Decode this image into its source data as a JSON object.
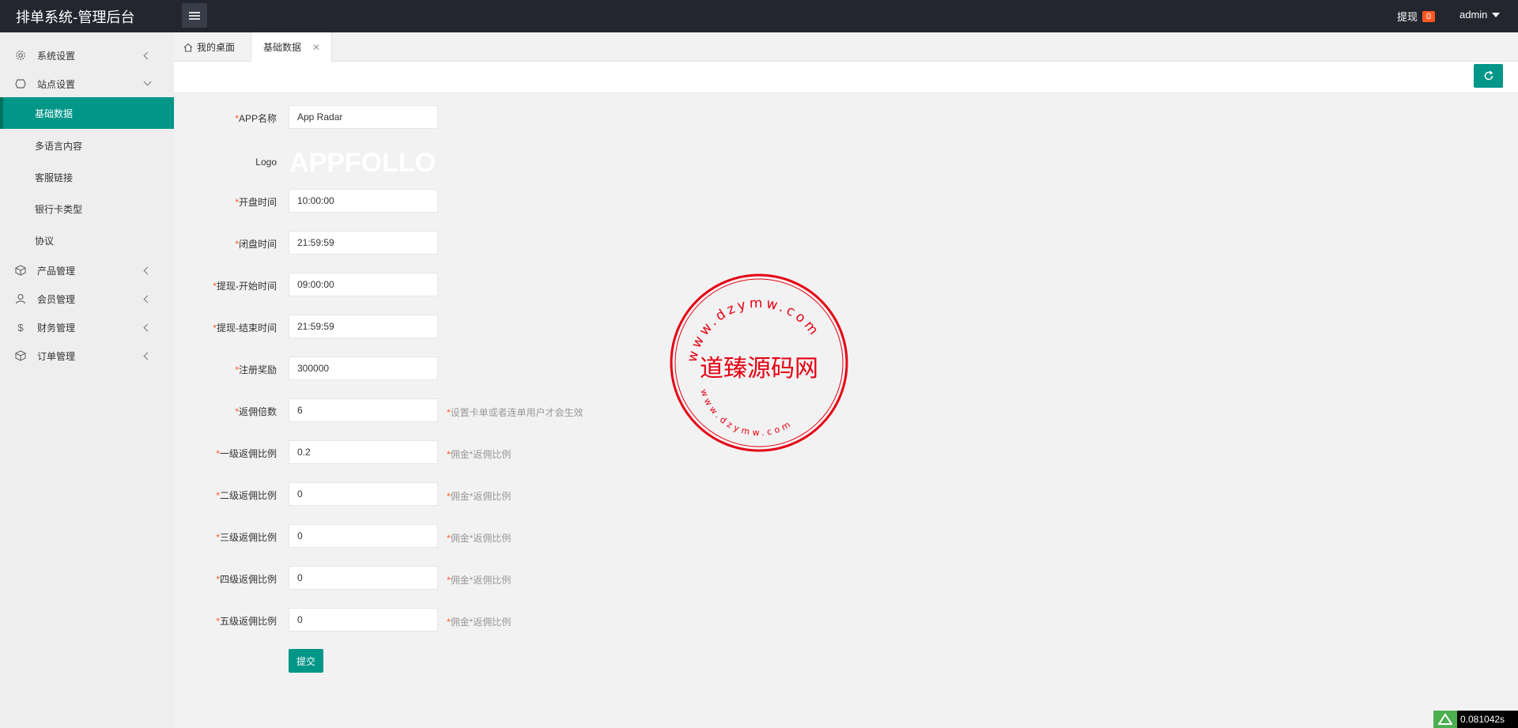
{
  "header": {
    "title": "排单系统-管理后台",
    "withdraw_label": "提现",
    "withdraw_count": "0",
    "user_label": "admin"
  },
  "sidebar": {
    "items": [
      {
        "label": "系统设置",
        "icon": "gear-icon"
      },
      {
        "label": "站点设置",
        "icon": "site-icon"
      },
      {
        "label": "产品管理",
        "icon": "box-icon"
      },
      {
        "label": "会员管理",
        "icon": "user-icon"
      },
      {
        "label": "财务管理",
        "icon": "dollar-icon"
      },
      {
        "label": "订单管理",
        "icon": "order-icon"
      }
    ],
    "subitems": [
      {
        "label": "基础数据"
      },
      {
        "label": "多语言内容"
      },
      {
        "label": "客服链接"
      },
      {
        "label": "银行卡类型"
      },
      {
        "label": "协议"
      }
    ]
  },
  "tabs": {
    "home_label": "我的桌面",
    "current_label": "基础数据",
    "close_glyph": "✕"
  },
  "form": {
    "app_name": {
      "label": "APP名称",
      "value": "App Radar"
    },
    "logo": {
      "label": "Logo",
      "text": "APPFOLLO"
    },
    "open_time": {
      "label": "开盘时间",
      "value": "10:00:00"
    },
    "close_time": {
      "label": "闭盘时间",
      "value": "21:59:59"
    },
    "withdraw_start": {
      "label": "提现-开始时间",
      "value": "09:00:00"
    },
    "withdraw_end": {
      "label": "提现-结束时间",
      "value": "21:59:59"
    },
    "register_reward": {
      "label": "注册奖励",
      "value": "300000"
    },
    "commission_multiplier": {
      "label": "返佣倍数",
      "value": "6",
      "hint": "设置卡单或者连单用户才会生效"
    },
    "level1": {
      "label": "一级返佣比例",
      "value": "0.2",
      "hint": "佣金*返佣比例"
    },
    "level2": {
      "label": "二级返佣比例",
      "value": "0",
      "hint": "佣金*返佣比例"
    },
    "level3": {
      "label": "三级返佣比例",
      "value": "0",
      "hint": "佣金*返佣比例"
    },
    "level4": {
      "label": "四级返佣比例",
      "value": "0",
      "hint": "佣金*返佣比例"
    },
    "level5": {
      "label": "五级返佣比例",
      "value": "0",
      "hint": "佣金*返佣比例"
    },
    "required_mark": "*",
    "submit_label": "提交"
  },
  "watermark": {
    "center_text": "道臻源码网",
    "top_text": "www.dzymw.com",
    "bottom_text": "www.dzymw.com",
    "color": "#e60012"
  },
  "timer": {
    "value": "0.081042s"
  },
  "colors": {
    "accent": "#009688",
    "topbar": "#23262e",
    "badge": "#ff5722"
  }
}
